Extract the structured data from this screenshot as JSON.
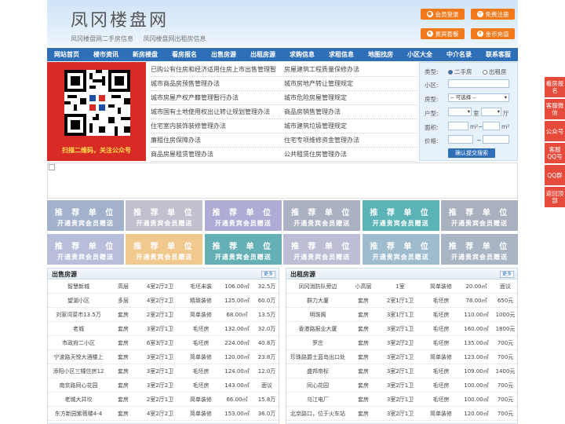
{
  "header": {
    "logo": "凤冈楼盘网",
    "subtitle": [
      "凤冈楼盘网二手房信息",
      "凤冈楼盘网出租房信息"
    ],
    "buttons": [
      {
        "label": "会员登录",
        "icon": "user-icon"
      },
      {
        "label": "免费注册",
        "icon": "register-icon"
      },
      {
        "label": "贵宾套餐",
        "icon": "vip-icon"
      },
      {
        "label": "金币充值",
        "icon": "coin-icon"
      }
    ]
  },
  "nav": [
    "网站首页",
    "楼市资讯",
    "新房楼盘",
    "看房报名",
    "出售房源",
    "出租房源",
    "求购信息",
    "求租信息",
    "地图找房",
    "小区大全",
    "中介名录",
    "联系客服"
  ],
  "qr": {
    "caption": "扫描二维码，关注公众号"
  },
  "links": [
    [
      "已购公有住房和经济适用住房上市出售管理暂",
      "房屋建筑工程质量保修办法"
    ],
    [
      "城市商品房预售管理办法",
      "城市房地产转让管理规定"
    ],
    [
      "城市房屋产权产籍管理暂行办法",
      "城市危险房屋管理规定"
    ],
    [
      "城市国有土地使用权出让转让规划管理办法",
      "商品房销售管理办法"
    ],
    [
      "住宅室内装饰装修管理办法",
      "城市建筑垃圾管理规定"
    ],
    [
      "廉租住房保障办法",
      "住宅专项维修资金管理办法"
    ],
    [
      "商品房屋租赁管理办法",
      "公共租赁住房管理办法"
    ]
  ],
  "search": {
    "type_label": "类型:",
    "options": [
      "二手房",
      "出租房"
    ],
    "community_label": "小区:",
    "housetype_label": "房型:",
    "housetype_value": "-- 可选择 --",
    "layout_label": "户型:",
    "room_unit": "室",
    "hall_unit": "厅",
    "area_label": "面积:",
    "area_unit": "m²",
    "price_label": "价格:",
    "tilde": "~",
    "submit": "确认提交搜索"
  },
  "ads": {
    "title": "推 荐 单 位",
    "sub": "开通贵宾会员赠送",
    "colors": [
      "#a2b2cc",
      "#c0c0ce",
      "#acacd4",
      "#a9b1c2",
      "#5bb3b6",
      "#a9b1bf",
      "#b8bed9",
      "#f1c98e",
      "#64b0b4",
      "#bdbdd6",
      "#9fbccf",
      "#a9b5c4"
    ]
  },
  "sale": {
    "title": "出售房源",
    "more": "更多",
    "rows": [
      [
        "智慧新城",
        "高层",
        "4室2厅2卫",
        "毛坯未装",
        "106.00㎡",
        "32.5万"
      ],
      [
        "望湖小区",
        "多层",
        "4室2厅2卫",
        "精致装修",
        "125.00㎡",
        "60.0万"
      ],
      [
        "刘家湾菜市13.5万",
        "套房",
        "2室2厅1卫",
        "简单装修",
        "68.00㎡",
        "13.5万"
      ],
      [
        "老城",
        "套房",
        "3室2厅1卫",
        "毛坯房",
        "132.00㎡",
        "32.0万"
      ],
      [
        "市政府二小区",
        "套房",
        "6室3厅2卫",
        "毛坯房",
        "224.00㎡",
        "40.8万"
      ],
      [
        "宁波路天悦大酒楼上",
        "套房",
        "3室2厅1卫",
        "简单装修",
        "120.00㎡",
        "23.8万"
      ],
      [
        "添阳小区三幢住房12",
        "套房",
        "3室2厅1卫",
        "毛坯房",
        "124.00㎡",
        "12.0万"
      ],
      [
        "南京路同心花园",
        "套房",
        "3室2厅2卫",
        "毛坯房",
        "143.00㎡",
        "面议"
      ],
      [
        "老城大井坎",
        "套房",
        "2室2厅1卫",
        "简单装修",
        "66.00㎡",
        "15.8万"
      ],
      [
        "东方新园紫薇楼4-4",
        "套房",
        "4室2厅2卫",
        "简单装修",
        "153.00㎡",
        "36.0万"
      ]
    ]
  },
  "rent": {
    "title": "出租房源",
    "more": "更多",
    "rows": [
      [
        "凤冈消防队旁边",
        "小高层",
        "1室",
        "简单装修",
        "20.00㎡",
        "面议"
      ],
      [
        "群力大厦",
        "套房",
        "2室1厅1卫",
        "毛坯房",
        "78.00㎡",
        "650元"
      ],
      [
        "明珠阁",
        "套房",
        "3室1厅1卫",
        "毛坯房",
        "110.00㎡",
        "1000元"
      ],
      [
        "香港路报业大厦",
        "套房",
        "3室2厅1卫",
        "毛坯房",
        "160.00㎡",
        "1800元"
      ],
      [
        "罗庄",
        "套房",
        "3室2厅2卫",
        "毛坯房",
        "135.00㎡",
        "700元"
      ],
      [
        "珍珠路爵士蓝岛出口处",
        "套房",
        "3室2厅1卫",
        "简单装修",
        "123.00㎡",
        "700元"
      ],
      [
        "盛邦帝标",
        "套房",
        "3室2厅1卫",
        "毛坯房",
        "109.00㎡",
        "1400元"
      ],
      [
        "同心花园",
        "套房",
        "3室2厅1卫",
        "毛坯房",
        "100.00㎡",
        "700元"
      ],
      [
        "乌江电厂",
        "套房",
        "3室2厅1卫",
        "毛坯房",
        "100.00㎡",
        "700元"
      ],
      [
        "北京路口，位于火车站",
        "套房",
        "3室2厅1卫",
        "简单装修",
        "120.00㎡",
        "700元"
      ]
    ]
  },
  "float": [
    "看房报名",
    "客服微信",
    "公众号",
    "客服QQ号",
    "QQ群",
    "返回顶部"
  ]
}
